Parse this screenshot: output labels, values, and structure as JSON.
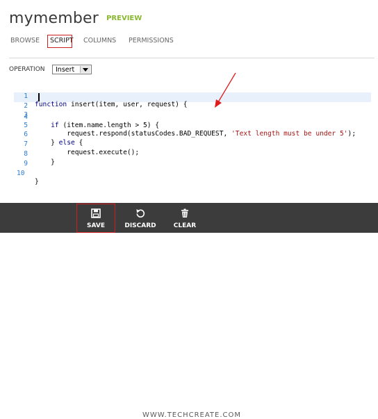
{
  "header": {
    "title": "mymember",
    "badge": "PREVIEW"
  },
  "tabs": [
    {
      "label": "BROWSE",
      "active": false
    },
    {
      "label": "SCRIPT",
      "active": true
    },
    {
      "label": "COLUMNS",
      "active": false
    },
    {
      "label": "PERMISSIONS",
      "active": false
    }
  ],
  "operation": {
    "label": "OPERATION",
    "value": "Insert"
  },
  "editor": {
    "lines": [
      {
        "no": "1",
        "text": "function insert(item, user, request) {"
      },
      {
        "no": "2",
        "text": ""
      },
      {
        "no": "3",
        "text": ""
      },
      {
        "no": "4",
        "text": "    if (item.name.length > 5) {"
      },
      {
        "no": "5",
        "text": "        request.respond(statusCodes.BAD_REQUEST, 'Text length must be under 5');"
      },
      {
        "no": "6",
        "text": "    } else {"
      },
      {
        "no": "7",
        "text": "        request.execute();"
      },
      {
        "no": "8",
        "text": "    }"
      },
      {
        "no": "9",
        "text": ""
      },
      {
        "no": "10",
        "text": "}"
      }
    ]
  },
  "bottombar": {
    "watermark": "WWW.TECHCREATE.COM",
    "commands": [
      {
        "label": "SAVE",
        "icon": "save-icon"
      },
      {
        "label": "DISCARD",
        "icon": "undo-icon"
      },
      {
        "label": "CLEAR",
        "icon": "trash-icon"
      }
    ]
  },
  "colors": {
    "accent_green": "#8ab82e",
    "highlight_red": "#cc1f1f",
    "bar_bg": "#3c3c3c"
  }
}
